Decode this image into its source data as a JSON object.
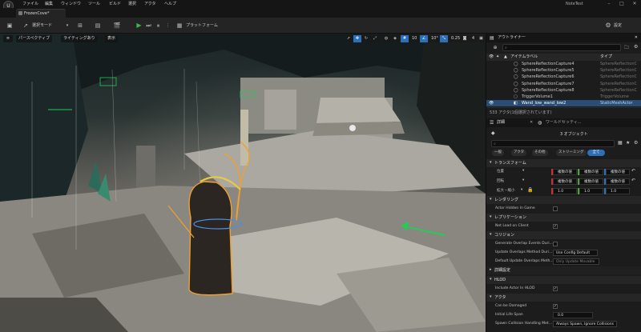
{
  "menu": [
    "ファイル",
    "編集",
    "ウィンドウ",
    "ツール",
    "ビルド",
    "選択",
    "アクタ",
    "ヘルプ"
  ],
  "project_name": "NoteTest",
  "level_tab": "FrozenCove*",
  "toolbar": {
    "selection_mode": "選択モード",
    "platform": "プラットフォーム",
    "settings": "設定"
  },
  "viewport": {
    "perspective": "パースペクティブ",
    "lighting": "ライティングあり",
    "show": "表示",
    "grid_snap": "10",
    "rotation_snap": "10°",
    "scale_snap": "0.25",
    "camera_speed": "4"
  },
  "outliner": {
    "title": "アウトライナー",
    "col_label": "アイテムラベル",
    "col_type": "タイプ",
    "rows": [
      {
        "label": "SphereReflectionCapture4",
        "type": "SphereReflectionC",
        "selected": false
      },
      {
        "label": "SphereReflectionCapture5",
        "type": "SphereReflectionC",
        "selected": false
      },
      {
        "label": "SphereReflectionCapture6",
        "type": "SphereReflectionC",
        "selected": false
      },
      {
        "label": "SphereReflectionCapture7",
        "type": "SphereReflectionC",
        "selected": false
      },
      {
        "label": "SphereReflectionCapture8",
        "type": "SphereReflectionC",
        "selected": false
      },
      {
        "label": "TriggerVolume1",
        "type": "TriggerVolume",
        "selected": false
      },
      {
        "label": "Wand_low_wand_low2",
        "type": "StaticMeshActor",
        "selected": true
      }
    ],
    "status": "533 アクタ(1個選択されています)"
  },
  "details": {
    "tab1": "詳細",
    "tab2": "ワールドセッティ...",
    "object_count": "3 オブジェクト",
    "filters": [
      "一般",
      "アクタ",
      "その他",
      "ストリーミング",
      "全て"
    ],
    "active_filter": 4,
    "sections": {
      "transform": "トランスフォーム",
      "rendering": "レンダリング",
      "replication": "レプリケーション",
      "collision": "コリジョン",
      "advanced": "詳細設定",
      "hlod": "HLOD",
      "actor": "アクタ"
    },
    "location": {
      "label": "位置",
      "x": "複数の値",
      "y": "複数の値",
      "z": "複数の値"
    },
    "rotation": {
      "label": "回転",
      "x": "複数の値",
      "y": "複数の値",
      "z": "複数の値"
    },
    "scale": {
      "label": "拡大・縮小",
      "x": "1.0",
      "y": "1.0",
      "z": "1.0"
    },
    "actor_hidden": "Actor Hidden In Game",
    "net_load": "Net Load on Client",
    "gen_overlap": "Generate Overlap Events Duri...",
    "update_overlaps": "Update Overlaps Method Duri...",
    "update_overlaps_val": "Use Config Default",
    "default_update": "Default Update Overlaps Meth...",
    "default_update_val": "Only Update Movable",
    "include_hlod": "Include Actor In HLOD",
    "can_be_damaged": "Can be Damaged",
    "initial_life": "Initial Life Span",
    "initial_life_val": "0.0",
    "spawn_collision": "Spawn Collision Handling Met...",
    "spawn_collision_val": "Always Spawn, Ignore Collisions"
  },
  "colors": {
    "accent": "#2d6fb8",
    "selection_outline": "#f0a030",
    "gizmo_green": "#22cc55",
    "x_axis": "#c53030",
    "y_axis": "#4ca33a",
    "z_axis": "#2d6fb8"
  }
}
